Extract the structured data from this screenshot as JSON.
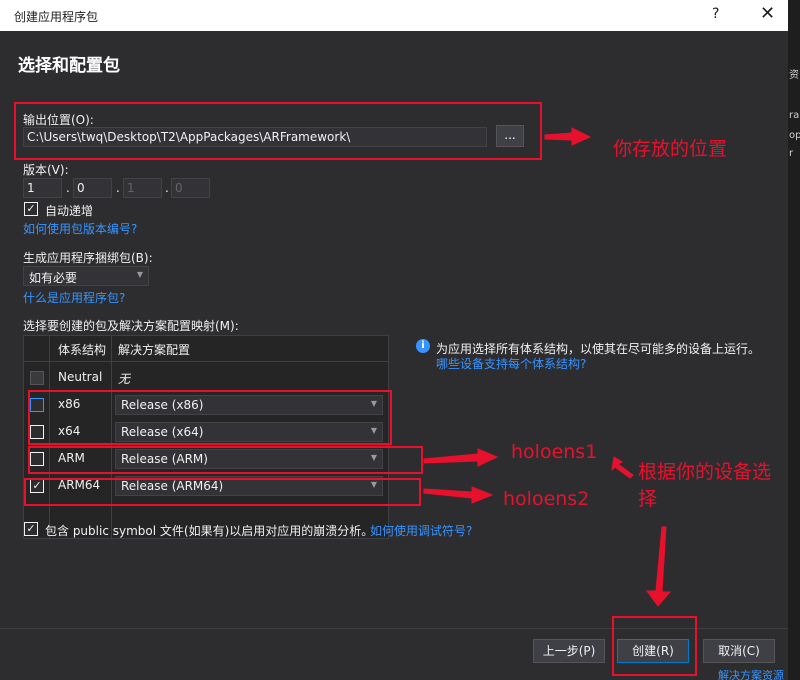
{
  "window": {
    "title": "创建应用程序包",
    "help_glyph": "?",
    "close_glyph": "✕"
  },
  "heading": "选择和配置包",
  "output": {
    "label": "输出位置(O):",
    "value": "C:\\Users\\twq\\Desktop\\T2\\AppPackages\\ARFramework\\",
    "browse_label": "..."
  },
  "version": {
    "label": "版本(V):",
    "parts": [
      "1",
      "0",
      "1",
      "0"
    ],
    "auto_increment_label": "自动递增",
    "auto_increment_checked": true,
    "help_link": "如何使用包版本编号?"
  },
  "bundle": {
    "label": "生成应用程序捆绑包(B):",
    "value": "如有必要",
    "help_link": "什么是应用程序包?"
  },
  "packages": {
    "label": "选择要创建的包及解决方案配置映射(M):",
    "columns": [
      "体系结构",
      "解决方案配置"
    ],
    "rows": [
      {
        "arch": "Neutral",
        "config": "无",
        "checked": false,
        "has_combo": false
      },
      {
        "arch": "x86",
        "config": "Release (x86)",
        "checked": false,
        "has_combo": true
      },
      {
        "arch": "x64",
        "config": "Release (x64)",
        "checked": false,
        "has_combo": true
      },
      {
        "arch": "ARM",
        "config": "Release (ARM)",
        "checked": false,
        "has_combo": true
      },
      {
        "arch": "ARM64",
        "config": "Release (ARM64)",
        "checked": true,
        "has_combo": true
      }
    ]
  },
  "info": {
    "icon": "info-icon",
    "text": "为应用选择所有体系结构，以使其在尽可能多的设备上运行。",
    "link": "哪些设备支持每个体系结构?"
  },
  "symbols": {
    "checked": true,
    "label": "包含 public symbol 文件(如果有)以启用对应用的崩溃分析。",
    "link": "如何使用调试符号?"
  },
  "buttons": {
    "back": "上一步(P)",
    "create": "创建(R)",
    "cancel": "取消(C)"
  },
  "annotations": {
    "location": "你存放的位置",
    "holo1": "holoens1",
    "holo2": "holoens2",
    "device_line1": "根据你的设备选",
    "device_line2": "择"
  },
  "right_strip": [
    "资",
    "ra",
    "op",
    "r",
    "解决方案资源"
  ],
  "colors": {
    "annotation_red": "#e8112d",
    "link_blue": "#3794ff",
    "background": "#2d2d30"
  }
}
